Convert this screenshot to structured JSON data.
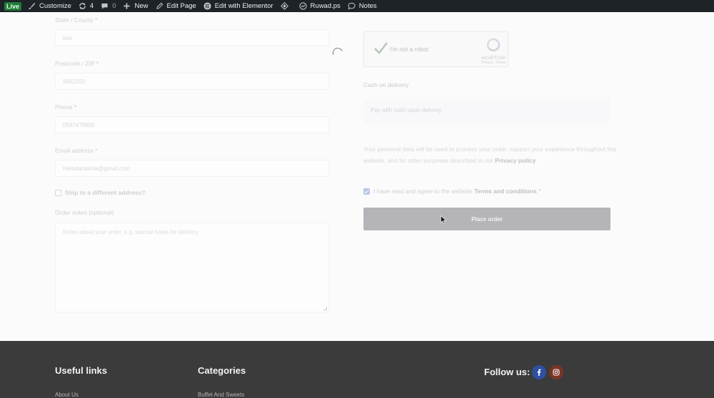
{
  "admin_bar": {
    "live_badge": "Live",
    "customize": "Customize",
    "updates_count": "4",
    "comments_count": "0",
    "new": "New",
    "edit_page": "Edit Page",
    "edit_elementor": "Edit with Elementor",
    "site_name": "Ruwad.ps",
    "notes": "Notes"
  },
  "billing": {
    "state_label": "State / County",
    "state_value": "test",
    "postcode_label": "Postcode / ZIP",
    "postcode_value": "9992200",
    "phone_label": "Phone",
    "phone_value": "0597478600",
    "email_label": "Email address",
    "email_value": "Hamdanbimia@gmail.com",
    "required_mark": "*",
    "ship_different": "Ship to a different address?",
    "order_notes_label": "Order notes (optional)",
    "order_notes_placeholder": "Notes about your order, e.g. special notes for delivery."
  },
  "payment": {
    "recaptcha_text": "I'm not a robot",
    "recaptcha_brand": "reCAPTCHA",
    "recaptcha_terms": "Privacy - Terms",
    "method_label": "Cash on delivery",
    "method_desc": "Pay with cash upon delivery.",
    "privacy_text": "Your personal data will be used to process your order, support your experience throughout this website, and for other purposes described in our",
    "privacy_link": "Privacy policy",
    "terms_text": "I have read and agree to the website",
    "terms_link": "Terms and conditions",
    "terms_required": "*",
    "place_order": "Place order"
  },
  "footer": {
    "useful_links_title": "Useful links",
    "useful_links": [
      "About Us"
    ],
    "categories_title": "Categories",
    "categories": [
      "Buffet And Sweets"
    ],
    "follow_title": "Follow us:",
    "social": [
      {
        "icon": "facebook-icon",
        "color": "#2f4fa0"
      },
      {
        "icon": "instagram-icon",
        "color": "#7a3526"
      }
    ]
  },
  "colors": {
    "admin_bar": "#1d2327",
    "live_badge": "#1f7a3a",
    "footer_bg": "#3b3b3c",
    "button": "#b5b5b9"
  }
}
